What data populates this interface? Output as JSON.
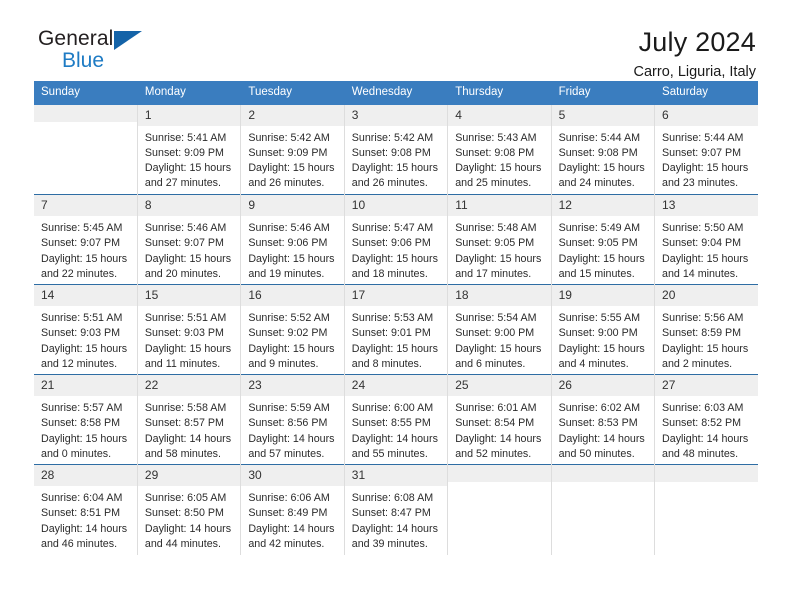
{
  "brand": {
    "name_top": "General",
    "name_bottom": "Blue",
    "accent_color": "#1463a8",
    "text_color": "#231f20"
  },
  "header": {
    "title": "July 2024",
    "subtitle": "Carro, Liguria, Italy"
  },
  "theme": {
    "header_row_bg": "#3a7dbf",
    "header_row_text": "#ffffff",
    "daynum_bg": "#efefef",
    "row_divider": "#2e6da4",
    "cell_divider": "#dddddd"
  },
  "weekday_headers": [
    "Sunday",
    "Monday",
    "Tuesday",
    "Wednesday",
    "Thursday",
    "Friday",
    "Saturday"
  ],
  "labels": {
    "sunrise_prefix": "Sunrise:",
    "sunset_prefix": "Sunset:",
    "daylight_prefix": "Daylight:"
  },
  "weeks": [
    [
      {
        "day": "",
        "blank": true,
        "sunrise": "",
        "sunset": "",
        "daylight_line1": "",
        "daylight_line2": ""
      },
      {
        "day": "1",
        "blank": false,
        "sunrise": "Sunrise: 5:41 AM",
        "sunset": "Sunset: 9:09 PM",
        "daylight_line1": "Daylight: 15 hours",
        "daylight_line2": "and 27 minutes."
      },
      {
        "day": "2",
        "blank": false,
        "sunrise": "Sunrise: 5:42 AM",
        "sunset": "Sunset: 9:09 PM",
        "daylight_line1": "Daylight: 15 hours",
        "daylight_line2": "and 26 minutes."
      },
      {
        "day": "3",
        "blank": false,
        "sunrise": "Sunrise: 5:42 AM",
        "sunset": "Sunset: 9:08 PM",
        "daylight_line1": "Daylight: 15 hours",
        "daylight_line2": "and 26 minutes."
      },
      {
        "day": "4",
        "blank": false,
        "sunrise": "Sunrise: 5:43 AM",
        "sunset": "Sunset: 9:08 PM",
        "daylight_line1": "Daylight: 15 hours",
        "daylight_line2": "and 25 minutes."
      },
      {
        "day": "5",
        "blank": false,
        "sunrise": "Sunrise: 5:44 AM",
        "sunset": "Sunset: 9:08 PM",
        "daylight_line1": "Daylight: 15 hours",
        "daylight_line2": "and 24 minutes."
      },
      {
        "day": "6",
        "blank": false,
        "sunrise": "Sunrise: 5:44 AM",
        "sunset": "Sunset: 9:07 PM",
        "daylight_line1": "Daylight: 15 hours",
        "daylight_line2": "and 23 minutes."
      }
    ],
    [
      {
        "day": "7",
        "blank": false,
        "sunrise": "Sunrise: 5:45 AM",
        "sunset": "Sunset: 9:07 PM",
        "daylight_line1": "Daylight: 15 hours",
        "daylight_line2": "and 22 minutes."
      },
      {
        "day": "8",
        "blank": false,
        "sunrise": "Sunrise: 5:46 AM",
        "sunset": "Sunset: 9:07 PM",
        "daylight_line1": "Daylight: 15 hours",
        "daylight_line2": "and 20 minutes."
      },
      {
        "day": "9",
        "blank": false,
        "sunrise": "Sunrise: 5:46 AM",
        "sunset": "Sunset: 9:06 PM",
        "daylight_line1": "Daylight: 15 hours",
        "daylight_line2": "and 19 minutes."
      },
      {
        "day": "10",
        "blank": false,
        "sunrise": "Sunrise: 5:47 AM",
        "sunset": "Sunset: 9:06 PM",
        "daylight_line1": "Daylight: 15 hours",
        "daylight_line2": "and 18 minutes."
      },
      {
        "day": "11",
        "blank": false,
        "sunrise": "Sunrise: 5:48 AM",
        "sunset": "Sunset: 9:05 PM",
        "daylight_line1": "Daylight: 15 hours",
        "daylight_line2": "and 17 minutes."
      },
      {
        "day": "12",
        "blank": false,
        "sunrise": "Sunrise: 5:49 AM",
        "sunset": "Sunset: 9:05 PM",
        "daylight_line1": "Daylight: 15 hours",
        "daylight_line2": "and 15 minutes."
      },
      {
        "day": "13",
        "blank": false,
        "sunrise": "Sunrise: 5:50 AM",
        "sunset": "Sunset: 9:04 PM",
        "daylight_line1": "Daylight: 15 hours",
        "daylight_line2": "and 14 minutes."
      }
    ],
    [
      {
        "day": "14",
        "blank": false,
        "sunrise": "Sunrise: 5:51 AM",
        "sunset": "Sunset: 9:03 PM",
        "daylight_line1": "Daylight: 15 hours",
        "daylight_line2": "and 12 minutes."
      },
      {
        "day": "15",
        "blank": false,
        "sunrise": "Sunrise: 5:51 AM",
        "sunset": "Sunset: 9:03 PM",
        "daylight_line1": "Daylight: 15 hours",
        "daylight_line2": "and 11 minutes."
      },
      {
        "day": "16",
        "blank": false,
        "sunrise": "Sunrise: 5:52 AM",
        "sunset": "Sunset: 9:02 PM",
        "daylight_line1": "Daylight: 15 hours",
        "daylight_line2": "and 9 minutes."
      },
      {
        "day": "17",
        "blank": false,
        "sunrise": "Sunrise: 5:53 AM",
        "sunset": "Sunset: 9:01 PM",
        "daylight_line1": "Daylight: 15 hours",
        "daylight_line2": "and 8 minutes."
      },
      {
        "day": "18",
        "blank": false,
        "sunrise": "Sunrise: 5:54 AM",
        "sunset": "Sunset: 9:00 PM",
        "daylight_line1": "Daylight: 15 hours",
        "daylight_line2": "and 6 minutes."
      },
      {
        "day": "19",
        "blank": false,
        "sunrise": "Sunrise: 5:55 AM",
        "sunset": "Sunset: 9:00 PM",
        "daylight_line1": "Daylight: 15 hours",
        "daylight_line2": "and 4 minutes."
      },
      {
        "day": "20",
        "blank": false,
        "sunrise": "Sunrise: 5:56 AM",
        "sunset": "Sunset: 8:59 PM",
        "daylight_line1": "Daylight: 15 hours",
        "daylight_line2": "and 2 minutes."
      }
    ],
    [
      {
        "day": "21",
        "blank": false,
        "sunrise": "Sunrise: 5:57 AM",
        "sunset": "Sunset: 8:58 PM",
        "daylight_line1": "Daylight: 15 hours",
        "daylight_line2": "and 0 minutes."
      },
      {
        "day": "22",
        "blank": false,
        "sunrise": "Sunrise: 5:58 AM",
        "sunset": "Sunset: 8:57 PM",
        "daylight_line1": "Daylight: 14 hours",
        "daylight_line2": "and 58 minutes."
      },
      {
        "day": "23",
        "blank": false,
        "sunrise": "Sunrise: 5:59 AM",
        "sunset": "Sunset: 8:56 PM",
        "daylight_line1": "Daylight: 14 hours",
        "daylight_line2": "and 57 minutes."
      },
      {
        "day": "24",
        "blank": false,
        "sunrise": "Sunrise: 6:00 AM",
        "sunset": "Sunset: 8:55 PM",
        "daylight_line1": "Daylight: 14 hours",
        "daylight_line2": "and 55 minutes."
      },
      {
        "day": "25",
        "blank": false,
        "sunrise": "Sunrise: 6:01 AM",
        "sunset": "Sunset: 8:54 PM",
        "daylight_line1": "Daylight: 14 hours",
        "daylight_line2": "and 52 minutes."
      },
      {
        "day": "26",
        "blank": false,
        "sunrise": "Sunrise: 6:02 AM",
        "sunset": "Sunset: 8:53 PM",
        "daylight_line1": "Daylight: 14 hours",
        "daylight_line2": "and 50 minutes."
      },
      {
        "day": "27",
        "blank": false,
        "sunrise": "Sunrise: 6:03 AM",
        "sunset": "Sunset: 8:52 PM",
        "daylight_line1": "Daylight: 14 hours",
        "daylight_line2": "and 48 minutes."
      }
    ],
    [
      {
        "day": "28",
        "blank": false,
        "sunrise": "Sunrise: 6:04 AM",
        "sunset": "Sunset: 8:51 PM",
        "daylight_line1": "Daylight: 14 hours",
        "daylight_line2": "and 46 minutes."
      },
      {
        "day": "29",
        "blank": false,
        "sunrise": "Sunrise: 6:05 AM",
        "sunset": "Sunset: 8:50 PM",
        "daylight_line1": "Daylight: 14 hours",
        "daylight_line2": "and 44 minutes."
      },
      {
        "day": "30",
        "blank": false,
        "sunrise": "Sunrise: 6:06 AM",
        "sunset": "Sunset: 8:49 PM",
        "daylight_line1": "Daylight: 14 hours",
        "daylight_line2": "and 42 minutes."
      },
      {
        "day": "31",
        "blank": false,
        "sunrise": "Sunrise: 6:08 AM",
        "sunset": "Sunset: 8:47 PM",
        "daylight_line1": "Daylight: 14 hours",
        "daylight_line2": "and 39 minutes."
      },
      {
        "day": "",
        "blank": true,
        "sunrise": "",
        "sunset": "",
        "daylight_line1": "",
        "daylight_line2": ""
      },
      {
        "day": "",
        "blank": true,
        "sunrise": "",
        "sunset": "",
        "daylight_line1": "",
        "daylight_line2": ""
      },
      {
        "day": "",
        "blank": true,
        "sunrise": "",
        "sunset": "",
        "daylight_line1": "",
        "daylight_line2": ""
      }
    ]
  ]
}
